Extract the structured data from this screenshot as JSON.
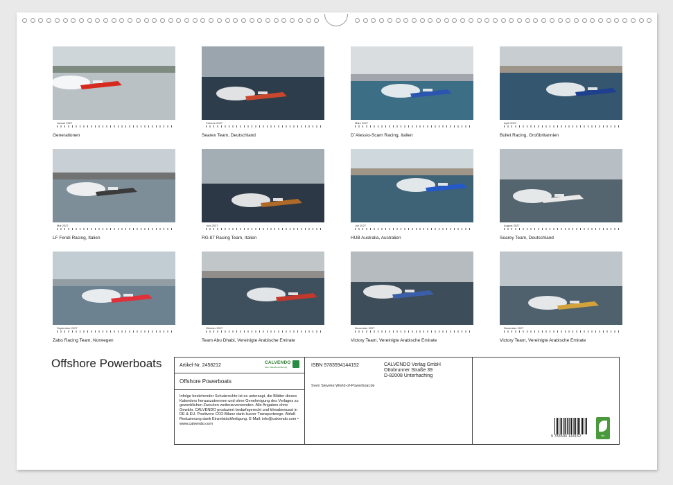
{
  "document": {
    "title": "Offshore Powerboats"
  },
  "months": [
    {
      "month": "Januar 2027",
      "caption": "Generationen",
      "sky": "#cfd6da",
      "water": "#b9c1c5",
      "accent": "#d62a1e",
      "land": "#5b6b5a"
    },
    {
      "month": "Februar 2027",
      "caption": "Searex Team, Deutschland",
      "sky": "#9aa5ad",
      "water": "#2e3d4c",
      "accent": "#c9482d",
      "land": "#9aa5ad"
    },
    {
      "month": "März 2027",
      "caption": "D´Alessio-Scam Racing, Italien",
      "sky": "#d9dde0",
      "water": "#3c6f85",
      "accent": "#2c55b0",
      "land": "#8a8f96"
    },
    {
      "month": "April 2027",
      "caption": "Bullet Racing, Großbritannien",
      "sky": "#c7cdd1",
      "water": "#35566f",
      "accent": "#1f3f8f",
      "land": "#8b7d6b"
    },
    {
      "month": "Mai 2027",
      "caption": "LF Fendi Racing, Italien",
      "sky": "#c9d0d5",
      "water": "#7e8e99",
      "accent": "#3b3b3b",
      "land": "#4c4c48"
    },
    {
      "month": "Juni 2027",
      "caption": "RG 87 Racing Team, Italien",
      "sky": "#a3adb4",
      "water": "#2c3845",
      "accent": "#b06a28",
      "land": "#a3adb4"
    },
    {
      "month": "Juli 2027",
      "caption": "HUB Australia, Australien",
      "sky": "#cfd8dc",
      "water": "#3e6276",
      "accent": "#2459c7",
      "land": "#8c7a64"
    },
    {
      "month": "August 2027",
      "caption": "Searey Team, Deutschland",
      "sky": "#b7bfc4",
      "water": "#55656f",
      "accent": "#e8e8e8",
      "land": "#b7bfc4"
    },
    {
      "month": "September 2027",
      "caption": "Zabo Racing Team, Norwegen",
      "sky": "#c2ccd3",
      "water": "#6d8291",
      "accent": "#e0303a",
      "land": "#7d8a8f"
    },
    {
      "month": "Oktober 2027",
      "caption": "Team Abu Dhabi, Vereinigte Arabische Emirate",
      "sky": "#c1c6c8",
      "water": "#3e4f5d",
      "accent": "#c2382c",
      "land": "#7a7570"
    },
    {
      "month": "November 2027",
      "caption": "Victory Team, Vereinigte Arabische Emirate",
      "sky": "#b5bbbf",
      "water": "#3d4d59",
      "accent": "#3a5fa8",
      "land": "#b5bbbf"
    },
    {
      "month": "Dezember 2027",
      "caption": "Victory Team, Vereinigte Arabische Emirate",
      "sky": "#bfc6cb",
      "water": "#4f616d",
      "accent": "#d4a23a",
      "land": "#bfc6cb"
    }
  ],
  "info": {
    "article": "Artikel-Nr. 2458212",
    "logo_name": "CALVENDO",
    "logo_tagline": "Sein Kalendersortierung",
    "box_title": "Offshore Powerboats",
    "legal": "Infolge bestehender Schutzrechte ist es untersagt, die Blätter dieses Kalenders herauszutrennen und ohne Genehmigung des Verlages zu gewerblichen Zwecken weiterzuverwenden. Alle Angaben ohne Gewähr. CALVENDO produziert bedarfsgerecht und klimabewusst in DE & EU. Positivere CO2-Bilanz dank kurzer Transportwege. Abfall-Reduzierung dank Einzelstückfertigung. E-Mail: info@calvendo.com • www.calvendo.com",
    "isbn": "ISBN 9783594144152",
    "publisher_line1": "CALVENDO Verlag GmbH",
    "publisher_line2": "Ottobrunner Straße 39",
    "publisher_line3": "D-82008 Unterhaching",
    "author": "Sven Sieveke World-of-Powerboat.de",
    "barcode_digits": "9 783594 144152",
    "eco_label": "fsc"
  }
}
